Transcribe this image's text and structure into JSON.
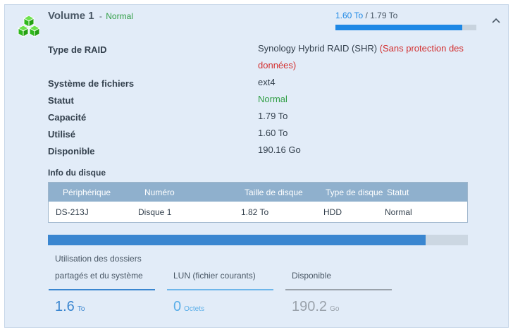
{
  "volume": {
    "name": "Volume 1",
    "separator": " - ",
    "status": "Normal",
    "usage_used": "1.60 To",
    "usage_separator": " / ",
    "usage_total": "1.79 To",
    "usage_fraction": 0.9
  },
  "properties": [
    {
      "label": "Type de RAID",
      "value": "Synology Hybrid RAID (SHR)",
      "value_extra": "(Sans protection des",
      "value_extra2": "données)"
    },
    {
      "label": "Système de fichiers",
      "value": "ext4"
    },
    {
      "label": "Statut",
      "value": "Normal"
    },
    {
      "label": "Capacité",
      "value": "1.79 To"
    },
    {
      "label": "Utilisé",
      "value": "1.60 To"
    },
    {
      "label": "Disponible",
      "value": "190.16 Go"
    }
  ],
  "disk_info": {
    "title": "Info du disque",
    "headers": [
      "Périphérique",
      "Numéro",
      "Taille de disque",
      "Type de disque",
      "Statut"
    ],
    "rows": [
      [
        "DS-213J",
        "Disque 1",
        "1.82 To",
        "HDD",
        "Normal"
      ]
    ]
  },
  "storage_bar": {
    "used_fraction": 0.899
  },
  "legend": {
    "shared_line1": "Utilisation des dossiers",
    "shared_line2": "partagés et du système",
    "lun": "LUN (fichier courants)",
    "available": "Disponible"
  },
  "stats": {
    "shared_value": "1.6",
    "shared_unit": "To",
    "lun_value": "0",
    "lun_unit": "Octets",
    "available_value": "190.2",
    "available_unit": "Go"
  },
  "colors": {
    "used": "#3a86d0",
    "lun": "#6eb6ea",
    "available": "#9aa2ab",
    "status_ok": "#2f9e44",
    "warning": "#d32f2f"
  }
}
